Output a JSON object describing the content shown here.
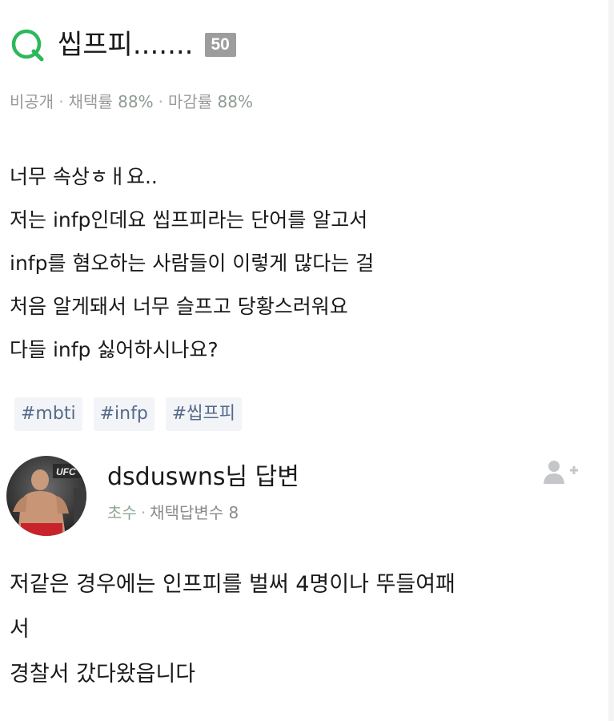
{
  "question": {
    "icon": "question-q-icon",
    "title": "씹프피.......",
    "points": "50",
    "meta": {
      "visibility": "비공개",
      "adoption_label": "채택률",
      "adoption_value": "88%",
      "close_label": "마감률",
      "close_value": "88%"
    },
    "body_lines": [
      "너무 속상ㅎㅐ요..",
      "저는 infp인데요 씹프피라는 단어를 알고서",
      "infp를 혐오하는 사람들이 이렇게 많다는 걸",
      "처음 알게돼서 너무 슬프고 당황스러워요",
      "다들 infp 싫어하시나요?"
    ],
    "tags": [
      "#mbti",
      "#infp",
      "#씹프피"
    ]
  },
  "answer": {
    "avatar_icon": "user-avatar",
    "author": "dsduswns님 답변",
    "grade": "초수",
    "adopted_label": "채택답변수 8",
    "follow_icon": "add-user-icon",
    "body_lines": [
      "저같은 경우에는 인프피를 벌써 4명이나 뚜들여패",
      "서",
      "경찰서 갔다왔읍니다"
    ]
  },
  "colors": {
    "brand_green": "#2db85c",
    "points_badge": "#9d9d9d",
    "tag_text": "#566a8a",
    "tag_bg": "#f2f4f7"
  }
}
